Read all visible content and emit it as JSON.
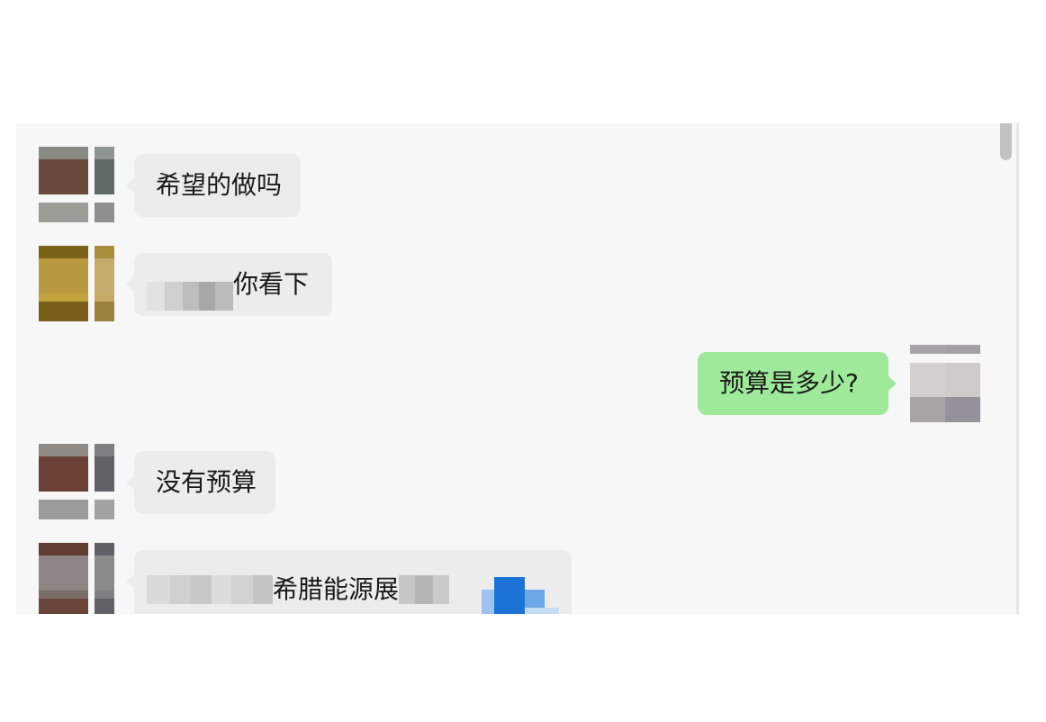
{
  "messages": [
    {
      "side": "incoming",
      "text": "希望的做吗"
    },
    {
      "side": "incoming",
      "text": "你看下",
      "redacted_prefix": true
    },
    {
      "side": "outgoing",
      "text": "预算是多少?"
    },
    {
      "side": "incoming",
      "text": "没有预算"
    },
    {
      "side": "incoming",
      "text": "希腊能源展",
      "redacted_prefix": true,
      "partial": true
    }
  ],
  "colors": {
    "panel_bg": "#f7f7f7",
    "incoming_bubble": "#ececec",
    "outgoing_bubble": "#9eea9a",
    "scrollbar_thumb": "#c2c2c2"
  }
}
